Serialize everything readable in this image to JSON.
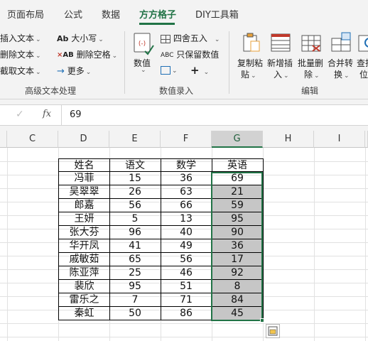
{
  "tabs": [
    {
      "label": "页面布局"
    },
    {
      "label": "公式"
    },
    {
      "label": "数据"
    },
    {
      "label": "方方格子",
      "active": true
    },
    {
      "label": "DIY工具箱"
    }
  ],
  "ribbon": {
    "text_group": {
      "insert": "插入文本",
      "delete": "删除文本",
      "extract": "截取文本",
      "case": "大小写",
      "delete_space": "删除空格",
      "more": "更多",
      "group_label": "高级文本处理"
    },
    "number_group": {
      "value": "数值",
      "round": "四舍五入",
      "keep_value": "只保留数值",
      "group_label": "数值录入"
    },
    "edit_group": {
      "copy_paste": "复制粘贴",
      "copy_paste_l1": "复制粘",
      "copy_paste_l2": "贴",
      "new_insert_l1": "新增插",
      "new_insert_l2": "入",
      "batch_delete_l1": "批量删",
      "batch_delete_l2": "除",
      "merge_l1": "合并转",
      "merge_l2": "换",
      "lookup_l1": "查找",
      "lookup_l2": "位",
      "group_label": "编辑"
    }
  },
  "formula_bar": {
    "fx": "fx",
    "value": "69"
  },
  "columns": [
    "C",
    "D",
    "E",
    "F",
    "G",
    "H",
    "I"
  ],
  "selected_column": "G",
  "table": {
    "headers": [
      "姓名",
      "语文",
      "数学",
      "英语"
    ],
    "rows": [
      [
        "冯菲",
        "15",
        "36",
        "69"
      ],
      [
        "吴翠翠",
        "26",
        "63",
        "21"
      ],
      [
        "郎嘉",
        "56",
        "66",
        "59"
      ],
      [
        "王妍",
        "5",
        "13",
        "95"
      ],
      [
        "张大芬",
        "96",
        "40",
        "90"
      ],
      [
        "华开凤",
        "41",
        "49",
        "36"
      ],
      [
        "戚敏茹",
        "65",
        "56",
        "17"
      ],
      [
        "陈亚萍",
        "25",
        "46",
        "92"
      ],
      [
        "裴欣",
        "95",
        "51",
        "8"
      ],
      [
        "雷乐之",
        "7",
        "71",
        "84"
      ],
      [
        "秦虹",
        "50",
        "86",
        "45"
      ]
    ]
  },
  "colors": {
    "accent": "#217346",
    "selection": "#c6c6c6",
    "ribbon_bg": "#f3f3f3"
  }
}
